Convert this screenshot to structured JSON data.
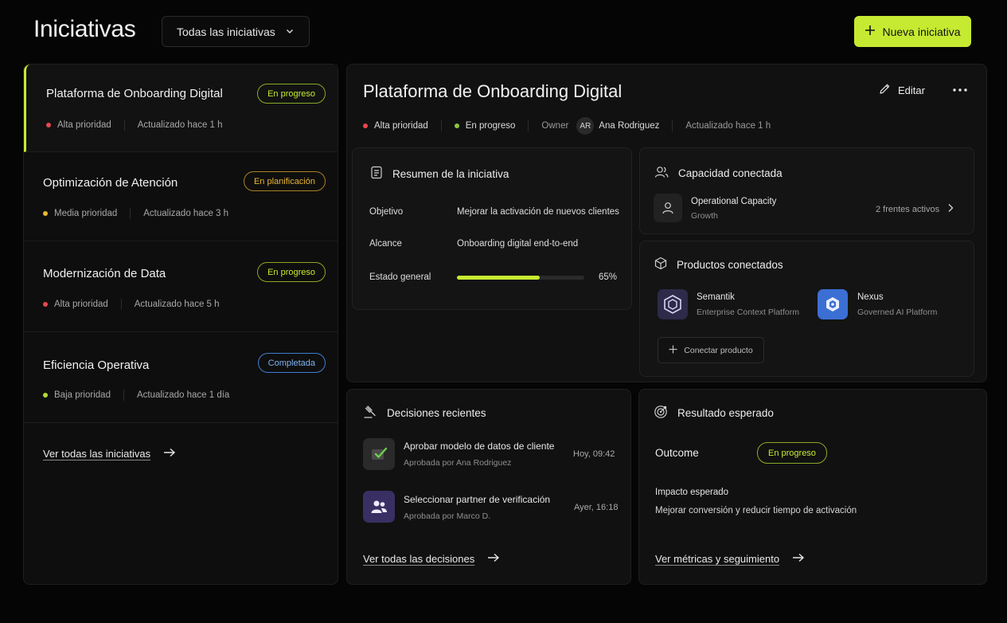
{
  "header": {
    "title": "Iniciativas",
    "filter_value": "Todas las iniciativas",
    "new_button": "Nueva iniciativa"
  },
  "colors": {
    "accent": "#c6ea31",
    "high_priority": "#e5484d",
    "medium_priority": "#e5b634",
    "low_priority": "#b4d936"
  },
  "initiatives": [
    {
      "title": "Plataforma de Onboarding Digital",
      "status": "En progreso",
      "priority": "Alta prioridad",
      "updated": "Actualizado hace 1 h"
    },
    {
      "title": "Optimización de Atención",
      "status": "En planificación",
      "priority": "Media prioridad",
      "updated": "Actualizado hace 3 h"
    },
    {
      "title": "Modernización de Data",
      "status": "En progreso",
      "priority": "Alta prioridad",
      "updated": "Actualizado hace 5 h"
    },
    {
      "title": "Eficiencia Operativa",
      "status": "Completada",
      "priority": "Baja prioridad",
      "updated": "Actualizado hace 1 día"
    }
  ],
  "see_all_initiatives": "Ver todas las iniciativas",
  "detail": {
    "title": "Plataforma de Onboarding Digital",
    "edit": "Editar",
    "priority": "Alta prioridad",
    "status": "En progreso",
    "owner_label": "Owner",
    "owner_initials": "AR",
    "owner_name": "Ana Rodriguez",
    "updated": "Actualizado hace 1 h"
  },
  "summary": {
    "title": "Resumen de la iniciativa",
    "objective_label": "Objetivo",
    "objective_value": "Mejorar la activación de nuevos clientes",
    "scope_label": "Alcance",
    "scope_value": "Onboarding digital end-to-end",
    "state_label": "Estado general",
    "progress": 65,
    "progress_text": "65%"
  },
  "capacity": {
    "title": "Capacidad conectada",
    "name": "Operational Capacity",
    "sub": "Growth",
    "fronts": "2 frentes activos"
  },
  "products": {
    "title": "Productos conectados",
    "items": [
      {
        "name": "Semantik",
        "sub": "Enterprise Context Platform"
      },
      {
        "name": "Nexus",
        "sub": "Governed AI Platform"
      }
    ],
    "connect": "Conectar producto"
  },
  "decisions": {
    "title": "Decisiones recientes",
    "items": [
      {
        "title": "Aprobar modelo de datos de cliente",
        "by": "Aprobada por Ana Rodriguez",
        "time": "Hoy, 09:42"
      },
      {
        "title": "Seleccionar partner de verificación",
        "by": "Aprobada por Marco D.",
        "time": "Ayer, 16:18"
      }
    ],
    "see_all": "Ver todas las decisiones"
  },
  "outcome": {
    "title": "Resultado esperado",
    "label": "Outcome",
    "status": "En progreso",
    "impact_label": "Impacto esperado",
    "impact_value": "Mejorar conversión y reducir tiempo de activación",
    "link": "Ver métricas y seguimiento"
  }
}
